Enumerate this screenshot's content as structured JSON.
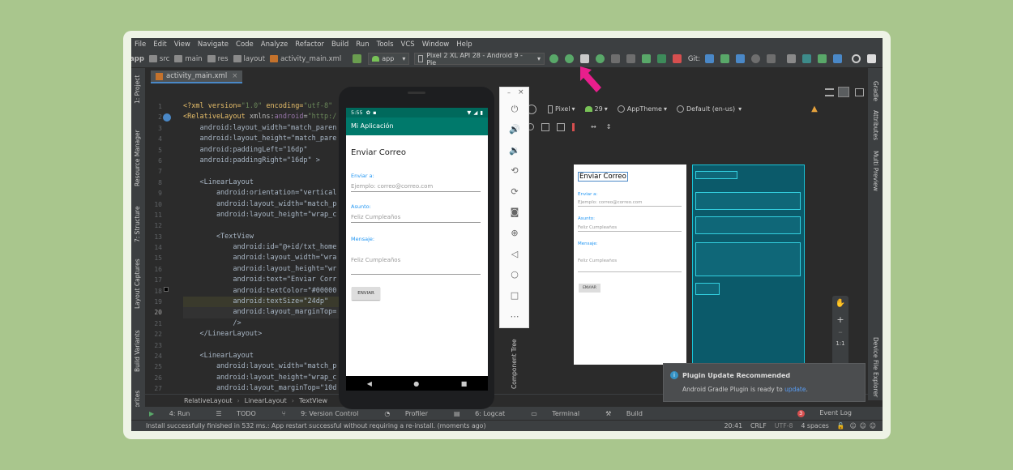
{
  "menu": [
    "File",
    "Edit",
    "View",
    "Navigate",
    "Code",
    "Analyze",
    "Refactor",
    "Build",
    "Run",
    "Tools",
    "VCS",
    "Window",
    "Help"
  ],
  "breadcrumbs": [
    "app",
    "src",
    "main",
    "res",
    "layout",
    "activity_main.xml"
  ],
  "run_config": "app",
  "device": "Pixel 2 XL API 28 - Android 9 - Pie",
  "git_label": "Git:",
  "file_tab": "activity_main.xml",
  "left_tools": [
    "1: Project",
    "Resource Manager",
    "7: Structure",
    "Layout Captures",
    "Build Variants",
    "orites"
  ],
  "right_tools": [
    "Gradle",
    "Attributes",
    "Multi Preview",
    "Device File Explorer"
  ],
  "line_numbers": [
    "1",
    "2",
    "3",
    "4",
    "5",
    "6",
    "7",
    "8",
    "9",
    "10",
    "11",
    "12",
    "13",
    "14",
    "15",
    "16",
    "17",
    "18",
    "19",
    "20",
    "21",
    "22",
    "23",
    "24",
    "25",
    "26",
    "27"
  ],
  "code": {
    "l1a": "<?xml version=",
    "l1b": "\"1.0\"",
    "l1c": " encoding=",
    "l1d": "\"utf-8\"",
    "l2a": "<RelativeLayout ",
    "l2b": "xmlns:",
    "l2c": "android",
    "l2d": "=",
    "l2e": "\"http:/",
    "l3": "    android:layout_width=\"match_paren",
    "l4": "    android:layout_height=\"match_pare",
    "l5": "    android:paddingLeft=\"16dp\"",
    "l6": "    android:paddingRight=\"16dp\" >",
    "l8": "    <LinearLayout",
    "l9": "        android:orientation=\"vertical",
    "l10": "        android:layout_width=\"match_p",
    "l11": "        android:layout_height=\"wrap_c",
    "l13": "        <TextView",
    "l14": "            android:id=\"@+id/txt_home",
    "l15": "            android:layout_width=\"wra",
    "l16": "            android:layout_height=\"wr",
    "l17": "            android:text=\"Enviar Corr",
    "l18": "            android:textColor=\"#00000",
    "l19": "            android:textSize=\"24dp\"",
    "l20": "            android:layout_marginTop=",
    "l21": "            />",
    "l22": "    </LinearLayout>",
    "l24": "    <LinearLayout",
    "l25": "        android:layout_width=\"match_p",
    "l26": "        android:layout_height=\"wrap_c",
    "l27": "        android:layout_marginTop=\"10d"
  },
  "code_breadcrumb": [
    "RelativeLayout",
    "LinearLayout",
    "TextView"
  ],
  "design_bar": {
    "device": "Pixel",
    "api": "29",
    "theme": "AppTheme",
    "locale": "Default (en-us)"
  },
  "component_tree": "Component Tree",
  "phone": {
    "time": "5:55",
    "app_title": "Mi Aplicación",
    "heading": "Enviar Correo",
    "to_label": "Enviar a:",
    "to_hint": "Ejemplo: correo@correo.com",
    "subject_label": "Asunto:",
    "subject_value": "Feliz Cumpleaños",
    "message_label": "Mensaje:",
    "message_value": "Feliz Cumpleaños",
    "button": "ENVIAR"
  },
  "preview": {
    "heading": "Enviar Correo",
    "to_label": "Enviar a:",
    "to_hint": "Ejemplo: correo@correo.com",
    "subject_label": "Asunto:",
    "subject_value": "Feliz Cumpleaños",
    "message_label": "Mensaje:",
    "message_value": "Feliz Cumpleaños",
    "button": "ENVIAR"
  },
  "notification": {
    "title": "Plugin Update Recommended",
    "text": "Android Gradle Plugin is ready to ",
    "link": "update",
    "suffix": "."
  },
  "bottom_tabs": [
    "4: Run",
    "TODO",
    "9: Version Control",
    "Profiler",
    "6: Logcat",
    "Terminal",
    "Build"
  ],
  "event_log": "Event Log",
  "event_count": "3",
  "status": {
    "message": "Install successfully finished in 532 ms.: App restart successful without requiring a re-install. (moments ago)",
    "pos": "20:41",
    "crlf": "CRLF",
    "enc": "UTF-8",
    "indent": "4 spaces"
  },
  "zoom": "1:1",
  "colors": {
    "accent": "#e91e8c",
    "android_green": "#03756b",
    "run_green": "#59a869"
  }
}
